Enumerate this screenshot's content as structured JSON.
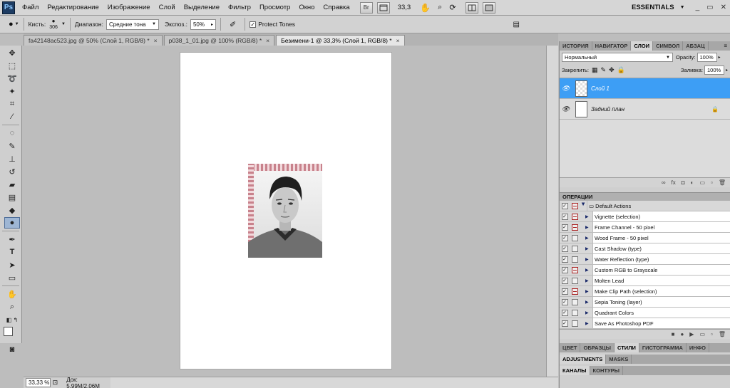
{
  "menubar": {
    "logo": "Ps",
    "items": [
      "Файл",
      "Редактирование",
      "Изображение",
      "Слой",
      "Выделение",
      "Фильтр",
      "Просмотр",
      "Окно",
      "Справка"
    ],
    "br_button": "Br",
    "zoom": "33,3",
    "workspace": "ESSENTIALS",
    "win_min": "_",
    "win_restore": "▭",
    "win_close": "✕"
  },
  "options": {
    "brush_label": "Кисть:",
    "brush_size": "306",
    "range_label": "Диапазон:",
    "range_value": "Средние тона",
    "exposure_label": "Экспоз.:",
    "exposure_value": "50%",
    "protect_label": "Protect Tones",
    "protect_checked": "✓"
  },
  "tabs": [
    {
      "label": "fa42148ac523.jpg @ 50% (Слой 1, RGB/8) *",
      "close": "×"
    },
    {
      "label": "p038_1_01.jpg @ 100% (RGB/8) *",
      "close": "×"
    },
    {
      "label": "Безимени-1 @ 33,3% (Слой 1, RGB/8) *",
      "close": "×"
    }
  ],
  "status": {
    "zoom": "33,33 %",
    "doc": "Док: 5,99M/2,06M"
  },
  "panels": {
    "top_tabs": [
      "ИСТОРИЯ",
      "НАВИГАТОР",
      "СЛОИ",
      "СИМВОЛ",
      "АБЗАЦ"
    ],
    "blend_mode": "Нормальный",
    "opacity_label": "Opacity:",
    "opacity_value": "100%",
    "lock_label": "Закрепить:",
    "fill_label": "Заливка:",
    "fill_value": "100%",
    "layers": [
      {
        "name": "Слой 1"
      },
      {
        "name": "Задний план"
      }
    ],
    "actions_header": "ОПЕРАЦИИ",
    "actions_set": "Default Actions",
    "actions": [
      "Vignette (selection)",
      "Frame Channel - 50 pixel",
      "Wood Frame - 50 pixel",
      "Cast Shadow (type)",
      "Water Reflection (type)",
      "Custom RGB to Grayscale",
      "Molten Lead",
      "Make Clip Path (selection)",
      "Sepia Toning (layer)",
      "Quadrant Colors",
      "Save As Photoshop PDF"
    ],
    "bottom_tabs_1": [
      "ЦВЕТ",
      "ОБРАЗЦЫ",
      "СТИЛИ",
      "ГИСТОГРАММА",
      "ИНФО"
    ],
    "bottom_tabs_2": [
      "ADJUSTMENTS",
      "MASKS"
    ],
    "bottom_tabs_3": [
      "КАНАЛЫ",
      "КОНТУРЫ"
    ]
  }
}
